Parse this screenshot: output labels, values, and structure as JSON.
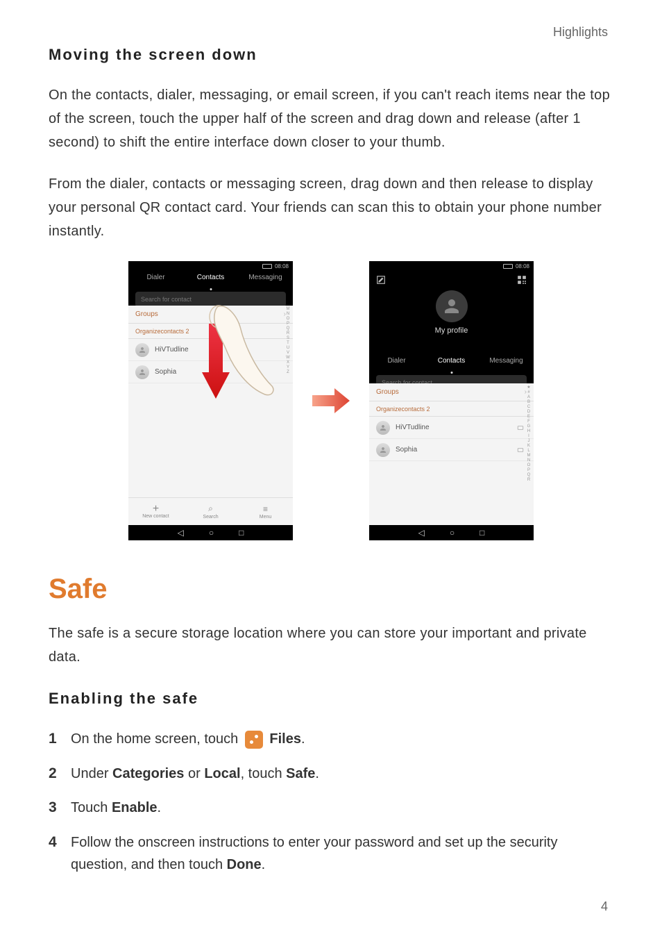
{
  "header": {
    "label": "Highlights"
  },
  "page_number": "4",
  "section1": {
    "title": "Moving the screen down",
    "para1": "On the contacts, dialer, messaging, or email screen, if you can't reach items near the top of the screen, touch the upper half of the screen and drag down and release (after 1 second) to shift the entire interface down closer to your thumb.",
    "para2": "From the dialer, contacts or messaging screen, drag down and then release to display your personal QR contact card. Your friends can scan this to obtain your phone number instantly."
  },
  "safe": {
    "title": "Safe",
    "intro": "The safe is a secure storage location where you can store your important and private data.",
    "sub": "Enabling the safe",
    "steps": {
      "s1a": "On the home screen, touch",
      "s1b": "Files",
      "s1c": ".",
      "s2a": "Under ",
      "s2b": "Categories",
      "s2c": " or ",
      "s2d": "Local",
      "s2e": ", touch ",
      "s2f": "Safe",
      "s2g": ".",
      "s3a": "Touch ",
      "s3b": "Enable",
      "s3c": ".",
      "s4a": "Follow the onscreen instructions to enter your password and set up the security question, and then touch ",
      "s4b": "Done",
      "s4c": "."
    }
  },
  "phone": {
    "time": "08:08",
    "tabs": {
      "dialer": "Dialer",
      "contacts": "Contacts",
      "messaging": "Messaging"
    },
    "search_placeholder": "Search for contact",
    "groups": "Groups",
    "org_header": "Organizecontacts 2",
    "contacts": {
      "c1": "HiVTudline",
      "c2": "Sophia"
    },
    "profile": "My profile",
    "actions": {
      "new_contact": "New contact",
      "search": "Search",
      "menu": "Menu"
    },
    "az": [
      "★",
      "#",
      "A",
      "B",
      "C",
      "D",
      "E",
      "F",
      "G",
      "H",
      "I",
      "J",
      "K",
      "L",
      "M",
      "N",
      "O",
      "P",
      "Q",
      "R",
      "S",
      "T",
      "U",
      "V",
      "W",
      "X",
      "Y",
      "Z"
    ],
    "az_short": [
      "M",
      "N",
      "O",
      "P",
      "Q",
      "R",
      "S",
      "T",
      "U",
      "V",
      "W",
      "X",
      "Y",
      "Z"
    ]
  }
}
